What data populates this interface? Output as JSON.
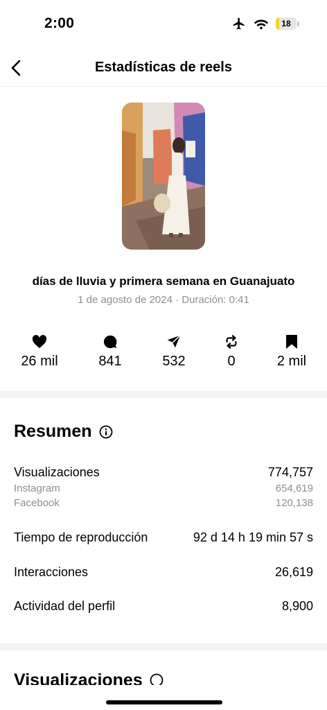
{
  "status_bar": {
    "time": "2:00",
    "battery_level": "18",
    "battery_fraction": 0.18,
    "icons": [
      "airplane-icon",
      "wifi-icon",
      "battery-icon"
    ]
  },
  "nav": {
    "title": "Estadísticas de reels",
    "back_icon": "chevron-left-icon"
  },
  "reel": {
    "title": "días de lluvia y primera semana en Guanajuato",
    "meta": "1 de agosto de 2024 · Duración: 0:41"
  },
  "counters": [
    {
      "icon": "heart-icon",
      "value": "26 mil"
    },
    {
      "icon": "comment-icon",
      "value": "841"
    },
    {
      "icon": "send-icon",
      "value": "532"
    },
    {
      "icon": "repost-icon",
      "value": "0"
    },
    {
      "icon": "bookmark-icon",
      "value": "2 mil"
    }
  ],
  "summary": {
    "title": "Resumen",
    "rows": {
      "views_label": "Visualizaciones",
      "views_value": "774,757",
      "instagram_label": "Instagram",
      "instagram_value": "654,619",
      "facebook_label": "Facebook",
      "facebook_value": "120,138",
      "watch_time_label": "Tiempo de reproducción",
      "watch_time_value": "92 d 14 h 19 min 57 s",
      "interactions_label": "Interacciones",
      "interactions_value": "26,619",
      "profile_activity_label": "Actividad del perfil",
      "profile_activity_value": "8,900"
    }
  },
  "next_section": {
    "title": "Visualizaciones"
  },
  "colors": {
    "battery_fill": "#f7d32a",
    "secondary_text": "#8e8e8e",
    "divider": "#f3f3f3"
  }
}
